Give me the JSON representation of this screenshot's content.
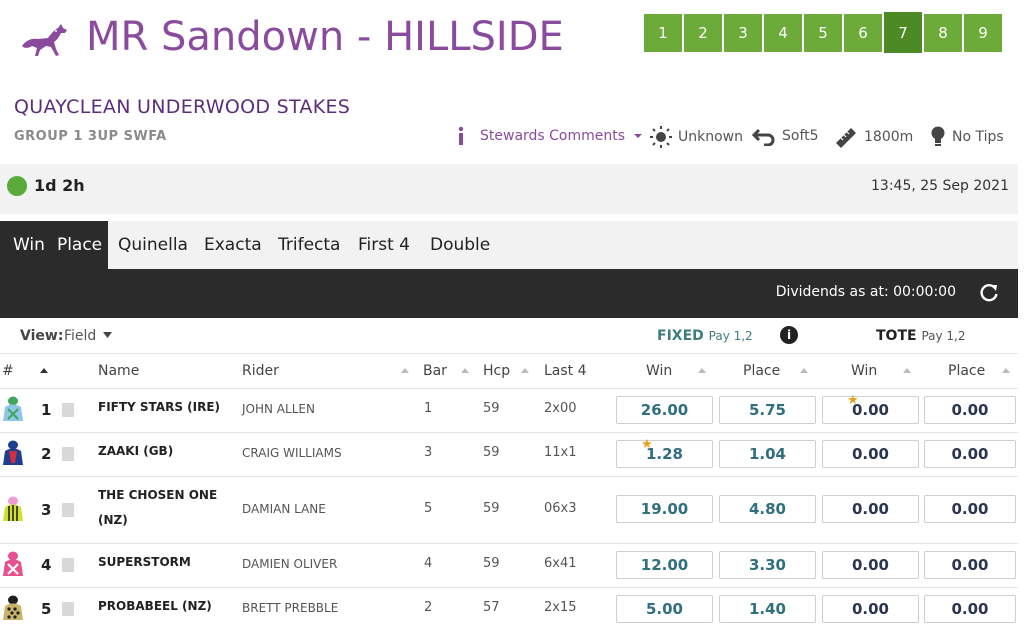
{
  "header": {
    "meeting_title": "MR Sandown - HILLSIDE",
    "races": [
      "1",
      "2",
      "3",
      "4",
      "5",
      "6",
      "7",
      "8",
      "9"
    ],
    "active_race": "7"
  },
  "race": {
    "name": "QUAYCLEAN UNDERWOOD STAKES",
    "class": "GROUP 1 3UP SWFA",
    "stewards_label": "Stewards Comments",
    "weather": "Unknown",
    "track": "Soft5",
    "distance": "1800m",
    "tips": "No Tips",
    "countdown": "1d 2h",
    "start_time": "13:45, 25 Sep 2021"
  },
  "tabs": [
    "Win",
    "Place",
    "Quinella",
    "Exacta",
    "Trifecta",
    "First 4",
    "Double"
  ],
  "dividends_text": "Dividends as at: 00:00:00",
  "view": {
    "label": "View:",
    "value": "Field"
  },
  "fixed": {
    "label": "FIXED",
    "pay": "Pay 1,2"
  },
  "tote": {
    "label": "TOTE",
    "pay": "Pay 1,2"
  },
  "columns": {
    "num": "#",
    "name": "Name",
    "rider": "Rider",
    "bar": "Bar",
    "hcp": "Hcp",
    "last4": "Last 4",
    "fixed_win": "Win",
    "fixed_place": "Place",
    "tote_win": "Win",
    "tote_place": "Place"
  },
  "runners": [
    {
      "num": "1",
      "name_line1": "FIFTY STARS (IRE)",
      "name_line2": "",
      "rider": "JOHN ALLEN",
      "bar": "1",
      "hcp": "59",
      "last4": "2x00",
      "fixed_win": "26.00",
      "fixed_place": "5.75",
      "tote_win": "0.00",
      "tote_place": "0.00",
      "star": "tote_win",
      "silk_colors": [
        "#3fa65a",
        "#8fc7e8",
        "#ffffff"
      ]
    },
    {
      "num": "2",
      "name_line1": "ZAAKI (GB)",
      "name_line2": "",
      "rider": "CRAIG WILLIAMS",
      "bar": "3",
      "hcp": "59",
      "last4": "11x1",
      "fixed_win": "1.28",
      "fixed_place": "1.04",
      "tote_win": "0.00",
      "tote_place": "0.00",
      "star": "fixed_win",
      "silk_colors": [
        "#1d3f8f",
        "#d22d3c",
        "#ffffff"
      ]
    },
    {
      "num": "3",
      "name_line1": "THE CHOSEN ONE",
      "name_line2": "(NZ)",
      "rider": "DAMIAN LANE",
      "bar": "5",
      "hcp": "59",
      "last4": "06x3",
      "fixed_win": "19.00",
      "fixed_place": "4.80",
      "tote_win": "0.00",
      "tote_place": "0.00",
      "star": "",
      "silk_colors": [
        "#cfe030",
        "#222222",
        "#ef9bd0"
      ]
    },
    {
      "num": "4",
      "name_line1": "SUPERSTORM",
      "name_line2": "",
      "rider": "DAMIEN OLIVER",
      "bar": "4",
      "hcp": "59",
      "last4": "6x41",
      "fixed_win": "12.00",
      "fixed_place": "3.30",
      "tote_win": "0.00",
      "tote_place": "0.00",
      "star": "",
      "silk_colors": [
        "#e6508e",
        "#ffffff",
        "#e6508e"
      ]
    },
    {
      "num": "5",
      "name_line1": "PROBABEEL (NZ)",
      "name_line2": "",
      "rider": "BRETT PREBBLE",
      "bar": "2",
      "hcp": "57",
      "last4": "2x15",
      "fixed_win": "5.00",
      "fixed_place": "1.40",
      "tote_win": "0.00",
      "tote_place": "0.00",
      "star": "",
      "silk_colors": [
        "#c9b56a",
        "#1f1f1f",
        "#c9b56a"
      ]
    }
  ]
}
